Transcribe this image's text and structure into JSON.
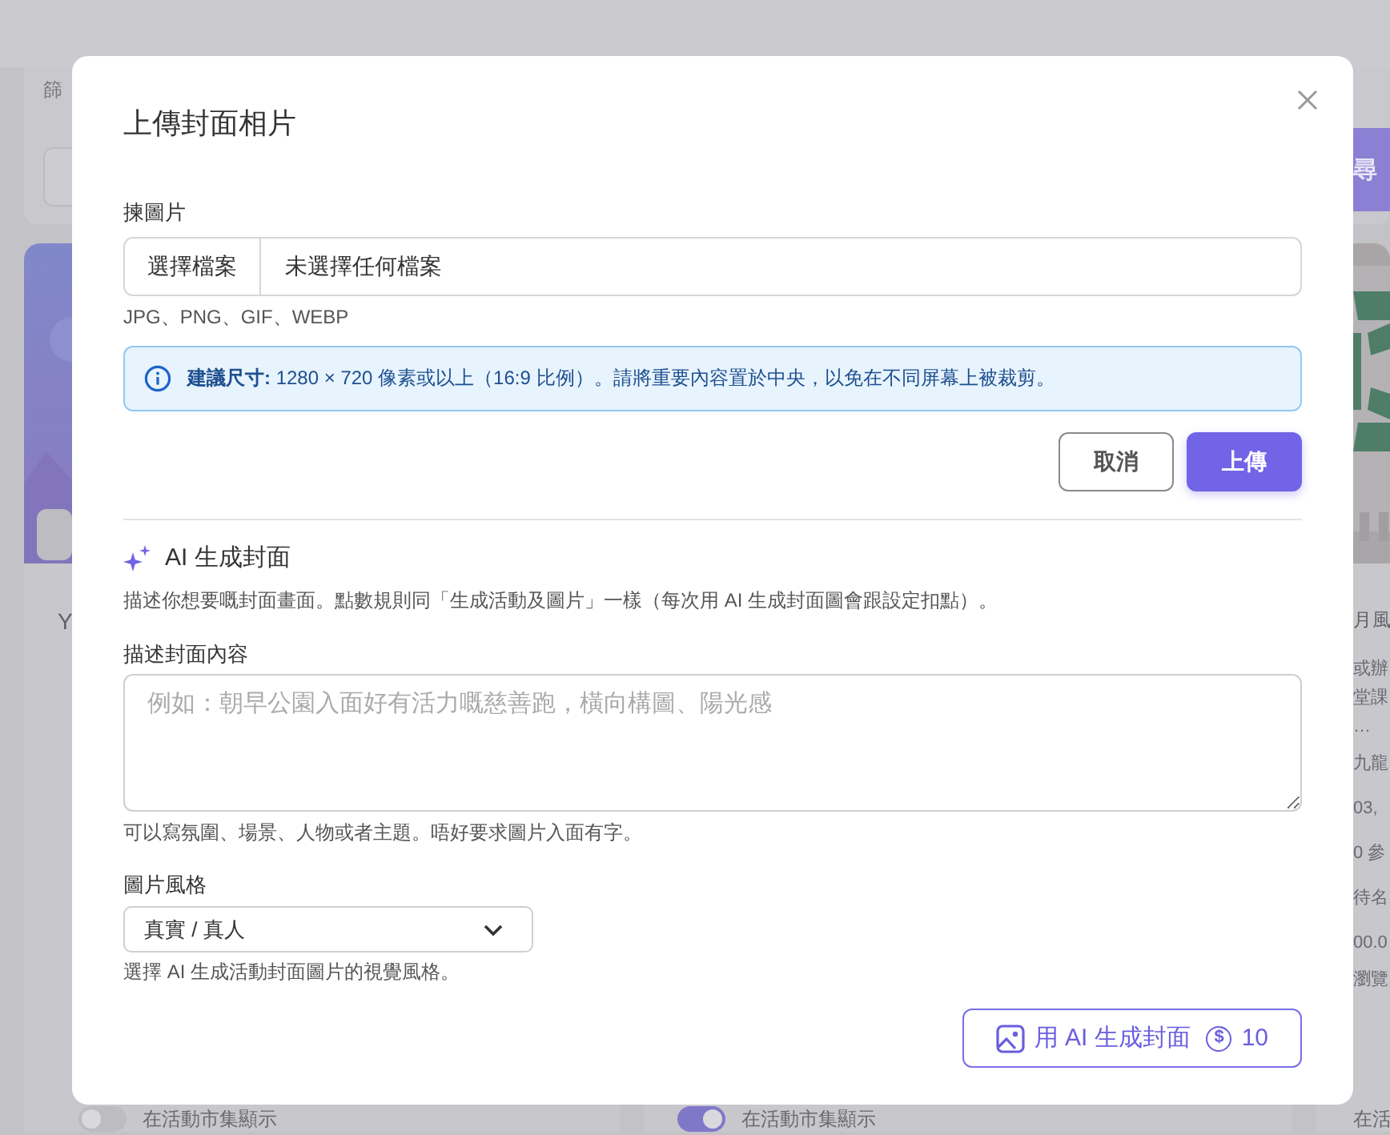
{
  "background": {
    "filter_label": "篩",
    "search_button": "尋",
    "cards": [
      {
        "title": "Y",
        "toggle": {
          "label": "在活動市集顯示",
          "on": false
        }
      },
      {
        "toggle": {
          "label": "在活動市集顯示",
          "on": true
        }
      },
      {
        "title": "月風",
        "lines": [
          {
            "text": "或辦",
            "kind": "desc"
          },
          {
            "text": "堂課",
            "kind": "desc"
          },
          {
            "text": "…",
            "kind": "desc"
          },
          {
            "text": "九龍",
            "kind": "meta"
          },
          {
            "text": "03,",
            "kind": "meta"
          },
          {
            "text": "0 參",
            "kind": "meta"
          },
          {
            "text": "待名",
            "kind": "meta"
          },
          {
            "text": "00.0",
            "kind": "meta"
          },
          {
            "text": "瀏覽",
            "kind": "desc"
          }
        ],
        "footer": "在活"
      }
    ]
  },
  "modal": {
    "title": "上傳封面相片",
    "upload": {
      "label": "揀圖片",
      "file_button": "選擇檔案",
      "file_status": "未選擇任何檔案",
      "formats": "JPG、PNG、GIF、WEBP",
      "notice": "**建議尺寸:** 1280 × 720 像素或以上（16:9 比例）。請將重要內容置於中央，以免在不同屏幕上被裁剪。",
      "buttons": [
        {
          "label": "取消",
          "kind": "secondary"
        },
        {
          "label": "上傳",
          "kind": "primary"
        }
      ]
    },
    "ai": {
      "heading": "AI 生成封面",
      "description": "描述你想要嘅封面畫面。點數規則同「生成活動及圖片」一樣（每次用 AI 生成封面圖會跟設定扣點）。",
      "prompt": {
        "label": "描述封面內容",
        "placeholder": "例如：朝早公園入面好有活力嘅慈善跑，橫向構圖、陽光感",
        "hint": "可以寫氛圍、場景、人物或者主題。唔好要求圖片入面有字。"
      },
      "style": {
        "label": "圖片風格",
        "value": "真實 / 真人",
        "hint": "選擇 AI 生成活動封面圖片的視覺風格。"
      },
      "generate": {
        "label": "用 AI 生成封面",
        "cost_symbol": "$",
        "cost": "10"
      }
    }
  }
}
